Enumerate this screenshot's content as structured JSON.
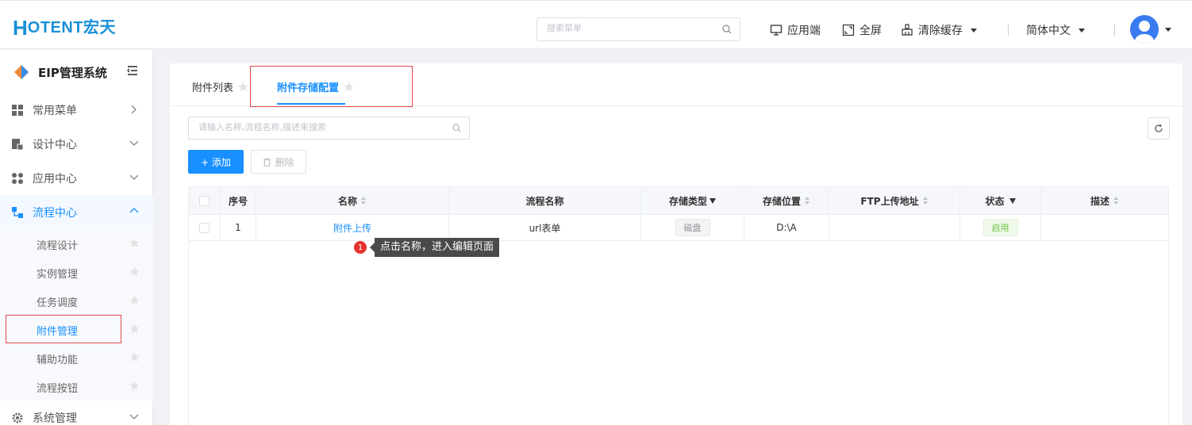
{
  "brand": {
    "logo_h": "H",
    "logo_rest": "OTENT宏天"
  },
  "header": {
    "search_placeholder": "搜索菜单",
    "app_end": "应用端",
    "fullscreen": "全屏",
    "clear_cache": "清除缓存",
    "language": "简体中文"
  },
  "sidebar": {
    "system_title": "EIP管理系统",
    "menus": [
      {
        "label": "常用菜单",
        "icon": "grid-icon"
      },
      {
        "label": "设计中心",
        "icon": "design-icon"
      },
      {
        "label": "应用中心",
        "icon": "apps-icon"
      },
      {
        "label": "流程中心",
        "icon": "flow-icon"
      },
      {
        "label": "系统管理",
        "icon": "gear-icon"
      }
    ],
    "submenus": [
      {
        "label": "流程设计"
      },
      {
        "label": "实例管理"
      },
      {
        "label": "任务调度"
      },
      {
        "label": "附件管理"
      },
      {
        "label": "辅助功能"
      },
      {
        "label": "流程按钮"
      }
    ]
  },
  "tabs": [
    {
      "label": "附件列表"
    },
    {
      "label": "附件存储配置"
    }
  ],
  "toolbar": {
    "search_placeholder": "请输入名称,流程名称,描述来搜索",
    "add_label": "+ 添加",
    "delete_label": "删除"
  },
  "table": {
    "columns": {
      "index": "序号",
      "name": "名称",
      "flow_name": "流程名称",
      "storage_type": "存储类型",
      "storage_location": "存储位置",
      "ftp_url": "FTP上传地址",
      "status": "状态",
      "description": "描述"
    },
    "rows": [
      {
        "index": "1",
        "name": "附件上传",
        "flow_name": "url表单",
        "storage_type": "磁盘",
        "storage_location": "D:\\A",
        "ftp_url": "",
        "status": "启用",
        "description": ""
      }
    ]
  },
  "tooltip": {
    "number": "1",
    "text": "点击名称，进入编辑页面"
  },
  "colors": {
    "primary": "#1890ff",
    "brand": "#1a8fd8",
    "highlight_box": "#e5484d",
    "tag_green": "#67c23a"
  }
}
